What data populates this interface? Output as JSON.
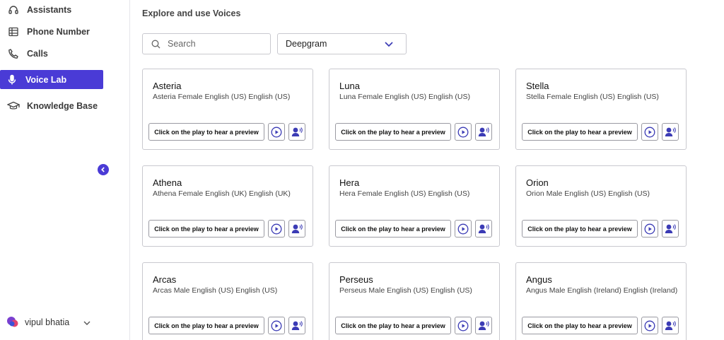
{
  "sidebar": {
    "items": [
      {
        "label": "Assistants",
        "icon": "headset-icon"
      },
      {
        "label": "Phone Number",
        "icon": "table-icon"
      },
      {
        "label": "Calls",
        "icon": "phone-icon"
      },
      {
        "label": "Voice Lab",
        "icon": "microphone-icon",
        "active": true
      },
      {
        "label": "Knowledge Base",
        "icon": "graduation-cap-icon"
      }
    ],
    "user_name": "vipul bhatia"
  },
  "main": {
    "title": "Explore and use Voices",
    "search_placeholder": "Search",
    "provider_selected": "Deepgram",
    "preview_label": "Click on the play to hear a preview",
    "voices": [
      {
        "name": "Asteria",
        "desc": "Asteria Female English (US) English (US)"
      },
      {
        "name": "Luna",
        "desc": "Luna Female English (US) English (US)"
      },
      {
        "name": "Stella",
        "desc": "Stella Female English (US) English (US)"
      },
      {
        "name": "Athena",
        "desc": "Athena Female English (UK) English (UK)"
      },
      {
        "name": "Hera",
        "desc": "Hera Female English (US) English (US)"
      },
      {
        "name": "Orion",
        "desc": "Orion Male English (US) English (US)"
      },
      {
        "name": "Arcas",
        "desc": "Arcas Male English (US) English (US)"
      },
      {
        "name": "Perseus",
        "desc": "Perseus Male English (US) English (US)"
      },
      {
        "name": "Angus",
        "desc": "Angus Male English (Ireland) English (Ireland)"
      }
    ]
  },
  "colors": {
    "accent": "#4a3bd6",
    "border": "#c9c9cf"
  }
}
